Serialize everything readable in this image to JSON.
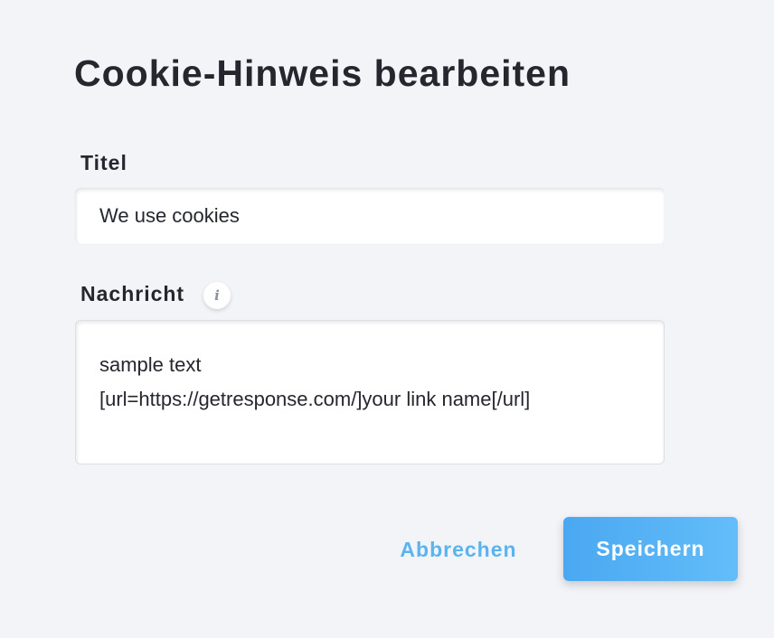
{
  "dialog": {
    "title": "Cookie-Hinweis bearbeiten"
  },
  "fields": {
    "title_label": "Titel",
    "title_value": "We use cookies",
    "message_label": "Nachricht",
    "message_info_glyph": "i",
    "message_value": "sample text\n[url=https://getresponse.com/]your link name[/url]"
  },
  "actions": {
    "cancel_label": "Abbrechen",
    "save_label": "Speichern"
  },
  "colors": {
    "background": "#f3f4f8",
    "text": "#24282e",
    "accent": "#5ab4ef",
    "primary_button_start": "#4aa8f2",
    "primary_button_end": "#63bdf8"
  },
  "icons": {
    "message_info": "info-icon"
  }
}
